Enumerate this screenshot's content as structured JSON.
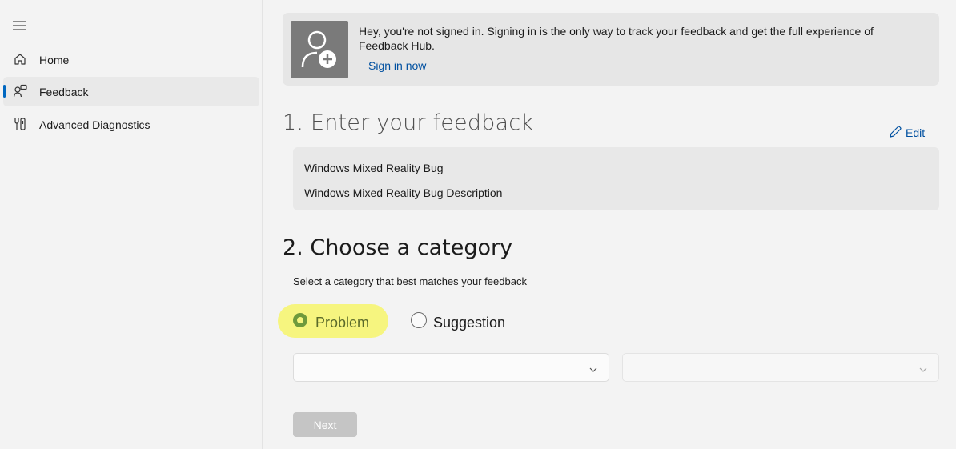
{
  "sidebar": {
    "items": [
      {
        "label": "Home",
        "icon": "home-icon"
      },
      {
        "label": "Feedback",
        "icon": "feedback-icon",
        "active": true
      },
      {
        "label": "Advanced Diagnostics",
        "icon": "diagnostics-icon"
      }
    ]
  },
  "banner": {
    "text": "Hey, you're not signed in. Signing in is the only way to track your feedback and get the full experience of Feedback Hub.",
    "link": "Sign in now",
    "icon": "add-user-icon"
  },
  "step1": {
    "heading": "1. Enter your feedback",
    "edit_label": "Edit",
    "title": "Windows Mixed Reality Bug",
    "description": "Windows Mixed Reality Bug Description"
  },
  "step2": {
    "heading": "2. Choose a category",
    "subtitle": "Select a category that best matches your feedback",
    "options": [
      {
        "label": "Problem",
        "selected": true
      },
      {
        "label": "Suggestion",
        "selected": false
      }
    ],
    "dropdown1_value": "",
    "dropdown2_value": ""
  },
  "next_label": "Next",
  "colors": {
    "accent": "#0067c0",
    "link": "#0050a0",
    "highlight": "#f6f57f",
    "selected_radio": "#6e9a3c"
  }
}
